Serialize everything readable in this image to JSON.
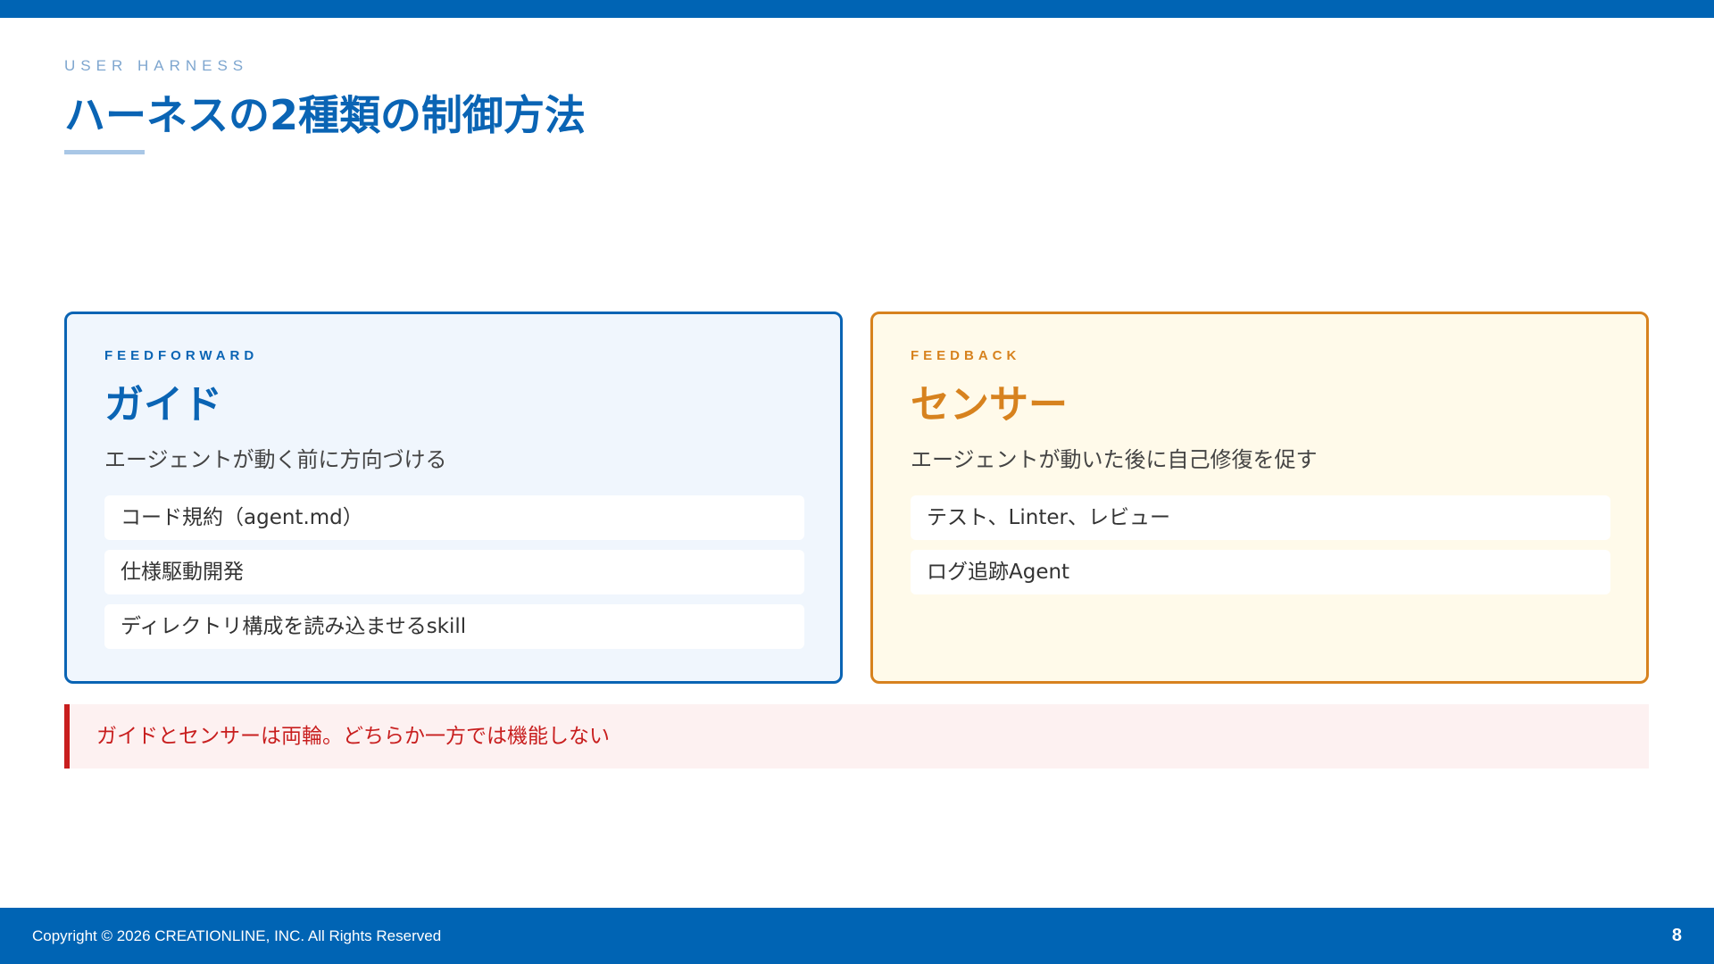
{
  "header": {
    "eyebrow": "USER HARNESS",
    "title": "ハーネスの2種類の制御方法"
  },
  "cards": {
    "feedforward": {
      "eyebrow": "FEEDFORWARD",
      "title": "ガイド",
      "description": "エージェントが動く前に方向づける",
      "items": [
        "コード規約（agent.md）",
        "仕様駆動開発",
        "ディレクトリ構成を読み込ませるskill"
      ]
    },
    "feedback": {
      "eyebrow": "FEEDBACK",
      "title": "センサー",
      "description": "エージェントが動いた後に自己修復を促す",
      "items": [
        "テスト、Linter、レビュー",
        "ログ追跡Agent"
      ]
    }
  },
  "callout": {
    "text": "ガイドとセンサーは両輪。どちらか一方では機能しない"
  },
  "footer": {
    "copyright": "Copyright © 2026 CREATIONLINE, INC. All Rights Reserved",
    "page_number": "8"
  },
  "colors": {
    "brand_blue": "#0064b4",
    "feedforward_accent": "#0a64b4",
    "feedback_accent": "#d7821e",
    "alert_red": "#c81e1e"
  }
}
